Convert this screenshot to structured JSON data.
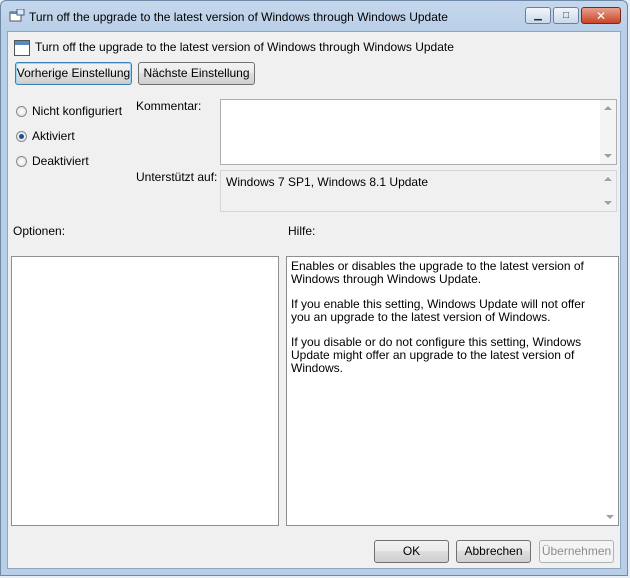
{
  "window": {
    "title": "Turn off the upgrade to the latest version of Windows through Windows Update",
    "minimize_glyph": "▁",
    "maximize_glyph": "□",
    "close_glyph": "✕"
  },
  "header": {
    "setting_name": "Turn off the upgrade to the latest version of Windows through Windows Update"
  },
  "nav": {
    "previous_label": "Vorherige Einstellung",
    "next_label": "Nächste Einstellung"
  },
  "state": {
    "selected": "Aktiviert",
    "options": [
      "Nicht konfiguriert",
      "Aktiviert",
      "Deaktiviert"
    ]
  },
  "comment": {
    "label": "Kommentar:",
    "value": ""
  },
  "supported": {
    "label": "Unterstützt auf:",
    "value": "Windows 7 SP1, Windows 8.1 Update"
  },
  "options_panel": {
    "label": "Optionen:"
  },
  "help_panel": {
    "label": "Hilfe:",
    "paragraphs": [
      "Enables or disables the upgrade to the latest version of Windows through Windows Update.",
      "If you enable this setting, Windows Update will not offer you an upgrade to the latest version of Windows.",
      "If you disable or do not configure this setting, Windows Update might offer an upgrade to the latest version of Windows."
    ]
  },
  "footer": {
    "ok_label": "OK",
    "cancel_label": "Abbrechen",
    "apply_label": "Übernehmen"
  },
  "colors": {
    "accent": "#1d4f91",
    "close_button": "#c8452a"
  }
}
